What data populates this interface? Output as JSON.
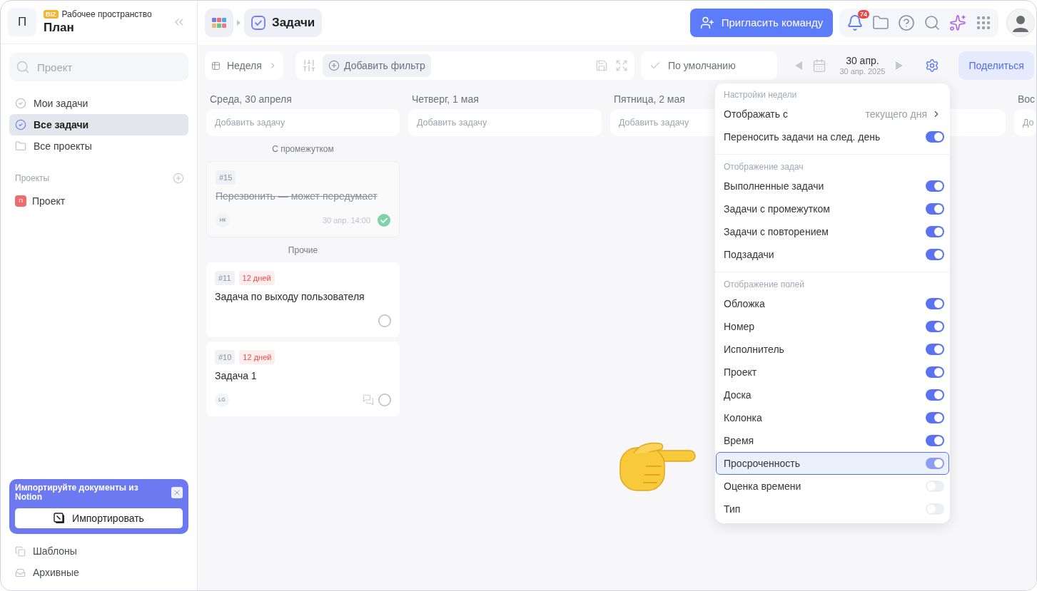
{
  "workspace": {
    "letter": "П",
    "badge": "BIZ",
    "label": "Рабочее пространство",
    "name": "План"
  },
  "sidebar": {
    "search": {
      "placeholder": "Проект"
    },
    "nav": [
      {
        "kind": "tasks",
        "label": "Мои задачи",
        "selected": false
      },
      {
        "kind": "tasks",
        "label": "Все задачи",
        "selected": true
      },
      {
        "kind": "folder",
        "label": "Все проекты",
        "selected": false
      }
    ],
    "projects_title": "Проекты",
    "projects": [
      {
        "letter": "П",
        "label": "Проект",
        "color": "#ef6b6e"
      }
    ],
    "promo": {
      "title": "Импортируйте документы из Notion",
      "button": "Импортировать"
    },
    "footer": [
      {
        "kind": "templates",
        "label": "Шаблоны"
      },
      {
        "kind": "archive",
        "label": "Архивные"
      }
    ]
  },
  "topbar": {
    "breadcrumb": "Задачи",
    "invite_button": "Пригласить команду",
    "notifications": "74"
  },
  "toolbar": {
    "view": "Неделя",
    "add_filter": "Добавить фильтр",
    "preset": "По умолчанию",
    "date": "30 апр.",
    "date_full": "30 апр. 2025",
    "share_button": "Поделиться"
  },
  "columns": [
    {
      "title": "Среда, 30 апреля",
      "add_task": "Добавить задачу",
      "groups": [
        {
          "title": "С промежутком",
          "cards": [
            {
              "number": "#15",
              "title": "Перезвонить — может передумает",
              "done": true,
              "assignee": "НК",
              "due": "30 апр. 14:00"
            }
          ]
        },
        {
          "title": "Прочие",
          "cards": [
            {
              "number": "#11",
              "overdue": "12 дней",
              "title": "Задача по выходу пользователя",
              "done": false
            },
            {
              "number": "#10",
              "overdue": "12 дней",
              "title": "Задача 1",
              "done": false,
              "assignee": "LG",
              "comments": true
            }
          ]
        }
      ]
    },
    {
      "title": "Четверг, 1 мая",
      "add_task": "Добавить задачу"
    },
    {
      "title": "Пятница, 2 мая",
      "add_task": "Добавить задачу"
    },
    {},
    {
      "title": "Вос",
      "add_task": "До"
    }
  ],
  "settings_menu": {
    "sections": [
      {
        "title": "Настройки недели",
        "items": [
          {
            "kind": "select",
            "label": "Отображать с",
            "value": "текущего дня",
            "highlighted": false
          },
          {
            "kind": "toggle",
            "label": "Переносить задачи на след. день",
            "on": true,
            "highlighted": false
          }
        ]
      },
      {
        "title": "Отображение задач",
        "items": [
          {
            "kind": "toggle",
            "label": "Выполненные задачи",
            "on": true,
            "highlighted": false
          },
          {
            "kind": "toggle",
            "label": "Задачи с промежутком",
            "on": true,
            "highlighted": false
          },
          {
            "kind": "toggle",
            "label": "Задачи с повторением",
            "on": true,
            "highlighted": false
          },
          {
            "kind": "toggle",
            "label": "Подзадачи",
            "on": true,
            "highlighted": false
          }
        ]
      },
      {
        "title": "Отображение полей",
        "items": [
          {
            "kind": "toggle",
            "label": "Обложка",
            "on": true,
            "highlighted": false
          },
          {
            "kind": "toggle",
            "label": "Номер",
            "on": true,
            "highlighted": false
          },
          {
            "kind": "toggle",
            "label": "Исполнитель",
            "on": true,
            "highlighted": false
          },
          {
            "kind": "toggle",
            "label": "Проект",
            "on": true,
            "highlighted": false
          },
          {
            "kind": "toggle",
            "label": "Доска",
            "on": true,
            "highlighted": false
          },
          {
            "kind": "toggle",
            "label": "Колонка",
            "on": true,
            "highlighted": false
          },
          {
            "kind": "toggle",
            "label": "Время",
            "on": true,
            "highlighted": false
          },
          {
            "kind": "toggle",
            "label": "Просроченность",
            "on": true,
            "highlighted": true
          },
          {
            "kind": "toggle",
            "label": "Оценка времени",
            "on": false,
            "highlighted": false
          },
          {
            "kind": "toggle",
            "label": "Тип",
            "on": false,
            "highlighted": false
          }
        ]
      }
    ]
  }
}
